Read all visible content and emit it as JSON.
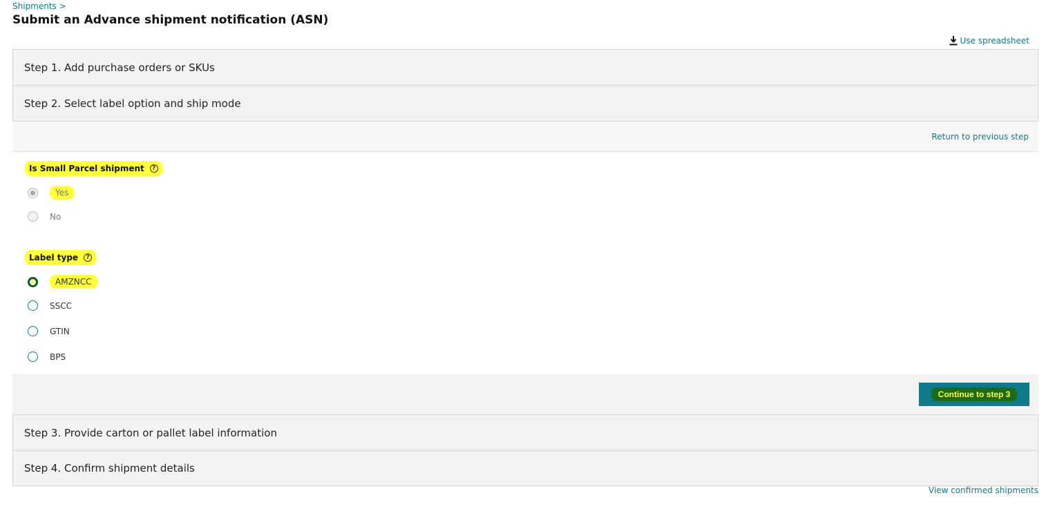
{
  "breadcrumb": {
    "link": "Shipments",
    "separator": ">"
  },
  "page_title": "Submit an Advance shipment notification (ASN)",
  "use_spreadsheet_label": "Use spreadsheet",
  "steps": {
    "step1": "Step 1. Add purchase orders or SKUs",
    "step2": "Step 2. Select label option and ship mode",
    "step3": "Step 3. Provide carton or pallet label information",
    "step4": "Step 4. Confirm shipment details"
  },
  "return_link": "Return to previous step",
  "small_parcel": {
    "label": "Is Small Parcel shipment",
    "help": "?",
    "options": [
      "Yes",
      "No"
    ],
    "selected": "Yes",
    "disabled": true
  },
  "label_type": {
    "label": "Label type",
    "help": "?",
    "options": [
      "AMZNCC",
      "SSCC",
      "GTIN",
      "BPS"
    ],
    "selected": "AMZNCC"
  },
  "continue_button": "Continue to step 3",
  "view_confirmed_link": "View confirmed shipments",
  "colors": {
    "accent": "#0f7a8a",
    "highlight": "#ffff3c",
    "panel": "#f3f3f3"
  }
}
